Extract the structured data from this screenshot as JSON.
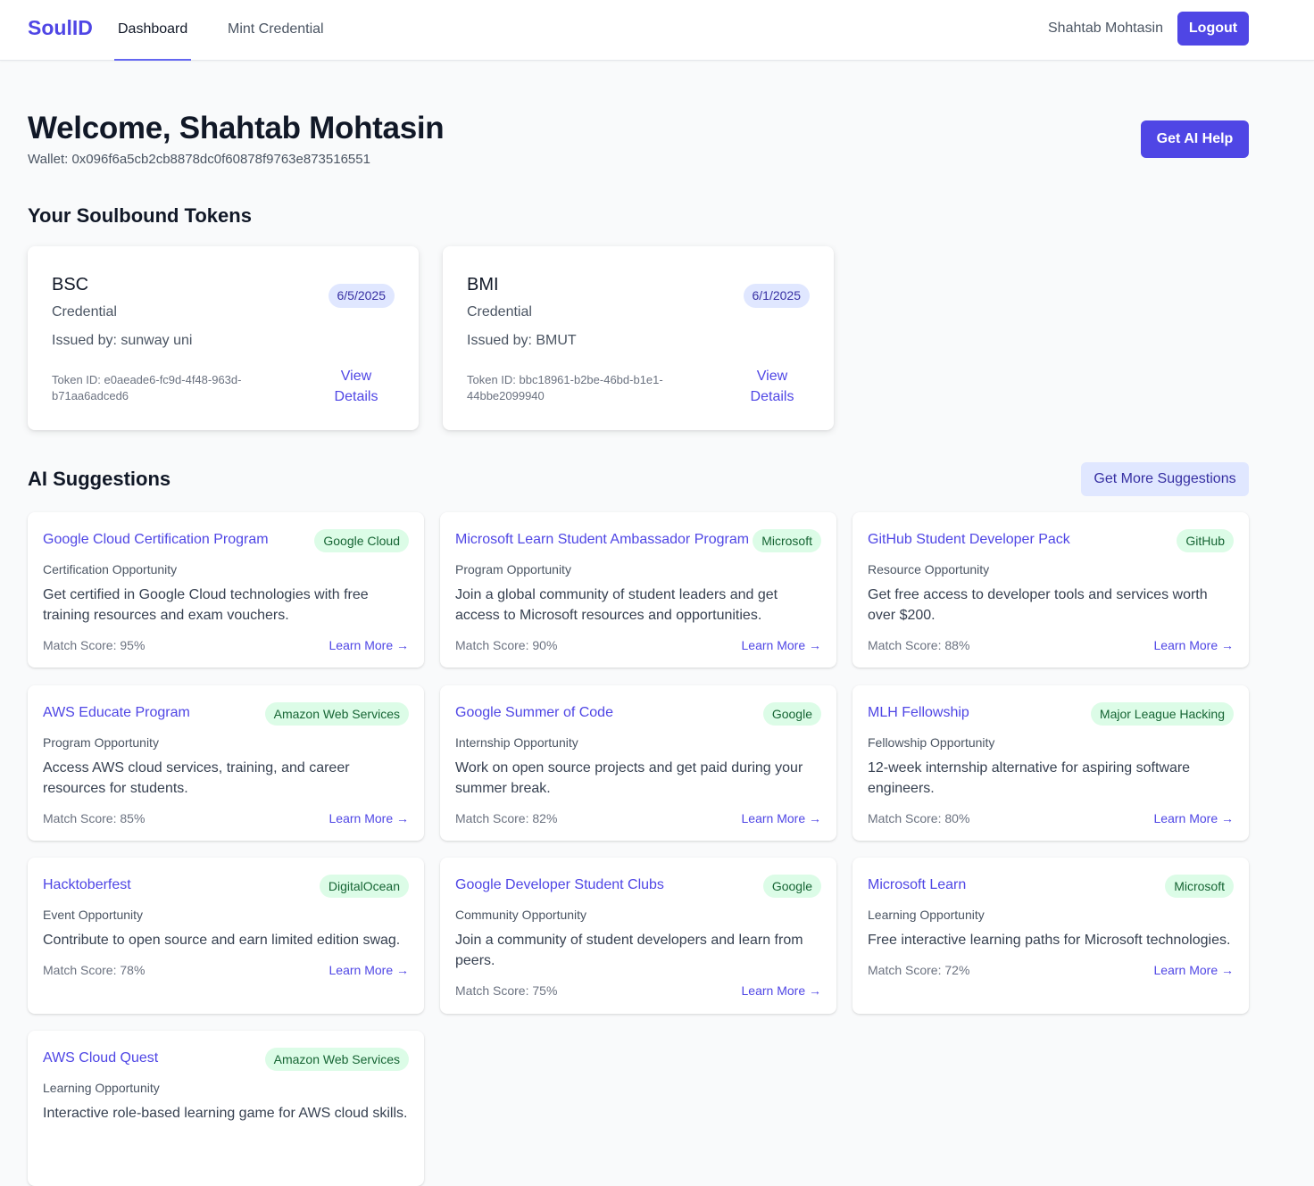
{
  "nav": {
    "brand": "SoulID",
    "tabs": [
      {
        "label": "Dashboard",
        "active": true
      },
      {
        "label": "Mint Credential",
        "active": false
      }
    ],
    "user_name": "Shahtab Mohtasin",
    "logout_label": "Logout"
  },
  "header": {
    "welcome": "Welcome, Shahtab Mohtasin",
    "wallet": "Wallet: 0x096f6a5cb2cb8878dc0f60878f9763e873516551",
    "ai_help_label": "Get AI Help"
  },
  "tokens": {
    "title": "Your Soulbound Tokens",
    "items": [
      {
        "name": "BSC",
        "type": "Credential",
        "issuer": "Issued by: sunway uni",
        "date": "6/5/2025",
        "token_id": "Token ID: e0aeade6-fc9d-4f48-963d-b71aa6adced6",
        "action": "View Details"
      },
      {
        "name": "BMI",
        "type": "Credential",
        "issuer": "Issued by: BMUT",
        "date": "6/1/2025",
        "token_id": "Token ID: bbc18961-b2be-46bd-b1e1-44bbe2099940",
        "action": "View Details"
      }
    ]
  },
  "suggestions": {
    "title": "AI Suggestions",
    "more_label": "Get More Suggestions",
    "learn_more_label": "Learn More →",
    "items": [
      {
        "title": "Google Cloud Certification Program",
        "badge": "Google Cloud",
        "type": "Certification Opportunity",
        "description": "Get certified in Google Cloud technologies with free training resources and exam vouchers.",
        "score": "Match Score: 95%"
      },
      {
        "title": "Microsoft Learn Student Ambassador Program",
        "badge": "Microsoft",
        "type": "Program Opportunity",
        "description": "Join a global community of student leaders and get access to Microsoft resources and opportunities.",
        "score": "Match Score: 90%"
      },
      {
        "title": "GitHub Student Developer Pack",
        "badge": "GitHub",
        "type": "Resource Opportunity",
        "description": "Get free access to developer tools and services worth over $200.",
        "score": "Match Score: 88%"
      },
      {
        "title": "AWS Educate Program",
        "badge": "Amazon Web Services",
        "type": "Program Opportunity",
        "description": "Access AWS cloud services, training, and career resources for students.",
        "score": "Match Score: 85%"
      },
      {
        "title": "Google Summer of Code",
        "badge": "Google",
        "type": "Internship Opportunity",
        "description": "Work on open source projects and get paid during your summer break.",
        "score": "Match Score: 82%"
      },
      {
        "title": "MLH Fellowship",
        "badge": "Major League Hacking",
        "type": "Fellowship Opportunity",
        "description": "12-week internship alternative for aspiring software engineers.",
        "score": "Match Score: 80%"
      },
      {
        "title": "Hacktoberfest",
        "badge": "DigitalOcean",
        "type": "Event Opportunity",
        "description": "Contribute to open source and earn limited edition swag.",
        "score": "Match Score: 78%"
      },
      {
        "title": "Google Developer Student Clubs",
        "badge": "Google",
        "type": "Community Opportunity",
        "description": "Join a community of student developers and learn from peers.",
        "score": "Match Score: 75%"
      },
      {
        "title": "Microsoft Learn",
        "badge": "Microsoft",
        "type": "Learning Opportunity",
        "description": "Free interactive learning paths for Microsoft technologies.",
        "score": "Match Score: 72%"
      },
      {
        "title": "AWS Cloud Quest",
        "badge": "Amazon Web Services",
        "type": "Learning Opportunity",
        "description": "Interactive role-based learning game for AWS cloud skills.",
        "score": ""
      }
    ]
  }
}
